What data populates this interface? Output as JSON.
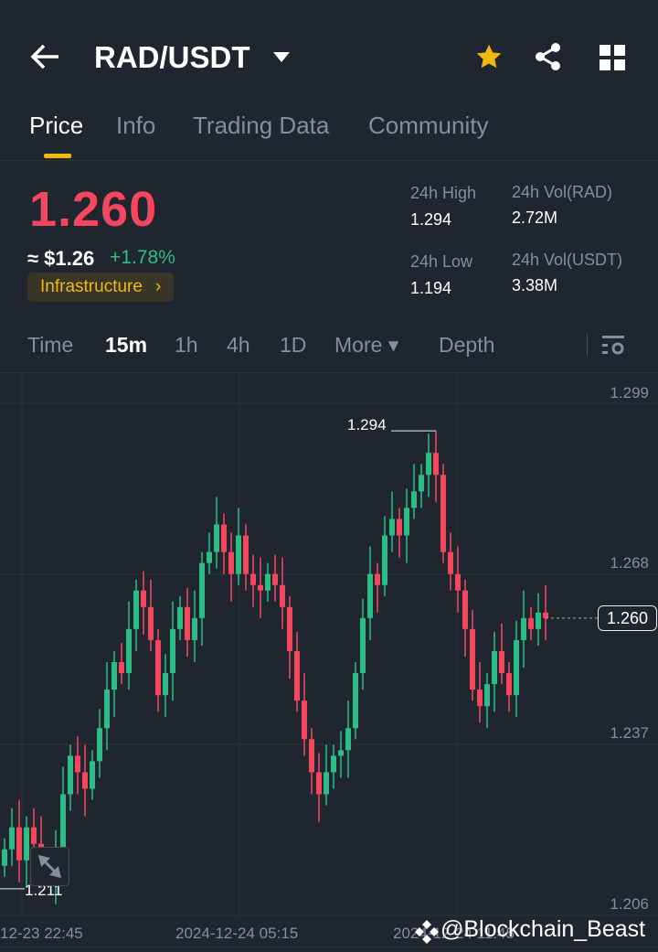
{
  "header": {
    "back_icon": "arrow-left",
    "title": "RAD/USDT",
    "icons": [
      "caret-down",
      "star",
      "share",
      "grid"
    ]
  },
  "tabs": [
    {
      "label": "Price",
      "active": true
    },
    {
      "label": "Info"
    },
    {
      "label": "Trading Data"
    },
    {
      "label": "Community"
    }
  ],
  "ticker": {
    "price": "1.260",
    "fiat": "≈ $1.26",
    "change": "+1.78%",
    "tag": "Infrastructure",
    "tag_arrow": "›"
  },
  "stats": {
    "high_label": "24h High",
    "high": "1.294",
    "low_label": "24h Low",
    "low": "1.194",
    "vol_base_label": "24h Vol(RAD)",
    "vol_base": "2.72M",
    "vol_quote_label": "24h Vol(USDT)",
    "vol_quote": "3.38M"
  },
  "intervals": [
    {
      "label": "Time"
    },
    {
      "label": "15m",
      "active": true
    },
    {
      "label": "1h"
    },
    {
      "label": "4h"
    },
    {
      "label": "1D"
    },
    {
      "label": "More ▾"
    },
    {
      "label": "Depth"
    }
  ],
  "colors": {
    "up": "#2ebd85",
    "down": "#f6465d",
    "accent": "#f0b90b"
  },
  "chart_data": {
    "type": "candlestick",
    "y_ticks": [
      "1.299",
      "1.268",
      "1.237",
      "1.206"
    ],
    "ylim": [
      1.206,
      1.299
    ],
    "x_ticks": [
      "12-23 22:45",
      "2024-12-24 05:15",
      "2024-12-24 11:45"
    ],
    "max_label": "1.294",
    "min_label": "1.211",
    "current": "1.260",
    "max_value": 1.294,
    "min_value": 1.211,
    "closes": [
      1.218,
      1.222,
      1.216,
      1.222,
      1.219,
      1.214,
      1.213,
      1.218,
      1.228,
      1.235,
      1.232,
      1.229,
      1.234,
      1.24,
      1.247,
      1.252,
      1.25,
      1.258,
      1.265,
      1.262,
      1.256,
      1.246,
      1.25,
      1.258,
      1.262,
      1.256,
      1.26,
      1.27,
      1.272,
      1.277,
      1.272,
      1.268,
      1.275,
      1.268,
      1.266,
      1.265,
      1.268,
      1.266,
      1.262,
      1.254,
      1.245,
      1.238,
      1.232,
      1.228,
      1.232,
      1.235,
      1.236,
      1.24,
      1.25,
      1.26,
      1.268,
      1.266,
      1.275,
      1.278,
      1.275,
      1.28,
      1.283,
      1.286,
      1.29,
      1.286,
      1.272,
      1.268,
      1.265,
      1.258,
      1.247,
      1.244,
      1.248,
      1.254,
      1.25,
      1.246,
      1.256,
      1.26,
      1.258,
      1.261,
      1.26
    ]
  },
  "watermark": "@Blockchain_Beast"
}
